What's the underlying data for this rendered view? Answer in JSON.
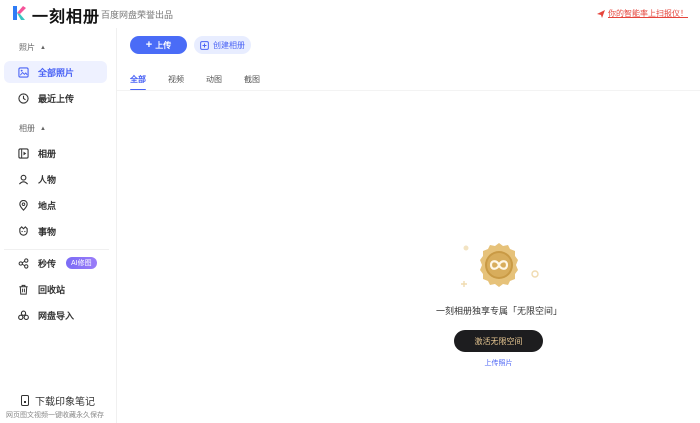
{
  "header": {
    "app_title": "一刻相册",
    "app_subtitle": "百度网盘荣誉出品",
    "promo_text": "你的智能率上扫报仪！"
  },
  "sidebar": {
    "section_photos": "照片",
    "section_albums": "相册",
    "items": [
      {
        "label": "全部照片",
        "icon": "photos-icon",
        "active": true
      },
      {
        "label": "最近上传",
        "icon": "clock-icon",
        "active": false
      },
      {
        "label": "相册",
        "icon": "album-icon",
        "active": false
      },
      {
        "label": "人物",
        "icon": "person-icon",
        "active": false
      },
      {
        "label": "地点",
        "icon": "location-icon",
        "active": false
      },
      {
        "label": "事物",
        "icon": "object-icon",
        "active": false
      },
      {
        "label": "秒传",
        "icon": "share-icon",
        "active": false,
        "badge": "AI修图"
      },
      {
        "label": "回收站",
        "icon": "trash-icon",
        "active": false
      },
      {
        "label": "网盘导入",
        "icon": "cloud-import-icon",
        "active": false
      }
    ],
    "download": {
      "label": "下载印象笔记",
      "subtext": "网页图文视频一键收藏永久保存"
    }
  },
  "toolbar": {
    "upload_label": "上传",
    "create_album_label": "创建相册"
  },
  "tabs": [
    {
      "label": "全部",
      "active": true
    },
    {
      "label": "视频",
      "active": false
    },
    {
      "label": "动图",
      "active": false
    },
    {
      "label": "截图",
      "active": false
    }
  ],
  "empty_state": {
    "title": "一刻相册独享专属「无限空间」",
    "activate_label": "激活无限空间",
    "upload_link": "上传照片"
  },
  "colors": {
    "accent": "#4a6cf7",
    "active_bg": "#eef1ff",
    "promo_red": "#e5443b",
    "gold": "#d9b46a",
    "dark_button": "#1d1d1f"
  }
}
